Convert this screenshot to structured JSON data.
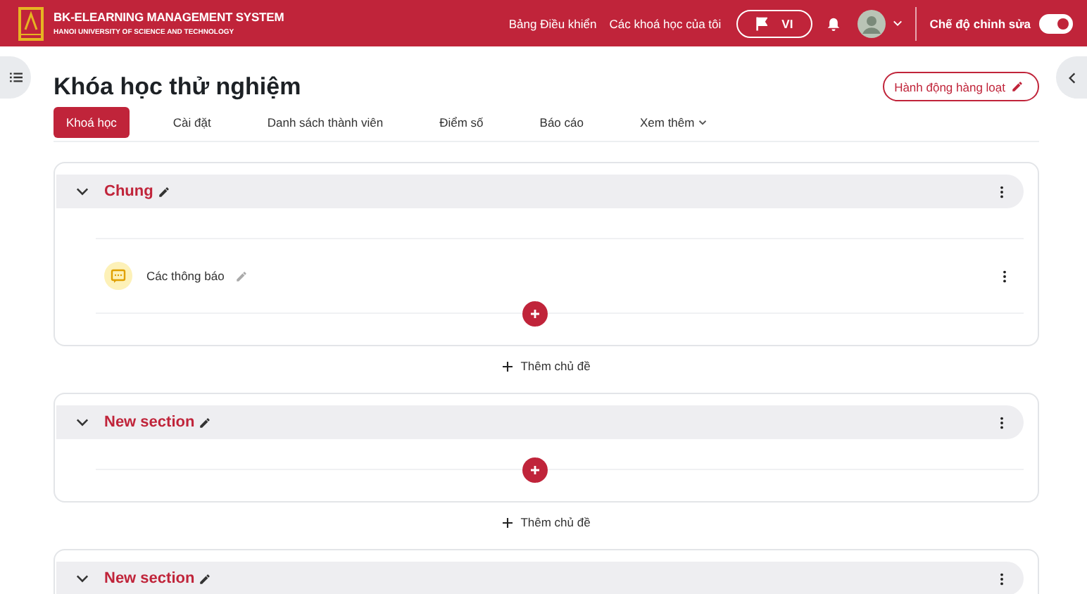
{
  "navbar": {
    "brand_title": "BK-ELEARNING MANAGEMENT SYSTEM",
    "brand_subtitle": "HANOI UNIVERSITY OF SCIENCE AND TECHNOLOGY",
    "links": [
      "Bảng Điều khiển",
      "Các khoá học của tôi"
    ],
    "language": "VI",
    "edit_mode": {
      "label": "Chế độ chỉnh sửa",
      "on": true
    }
  },
  "course": {
    "title": "Khóa học thử nghiệm",
    "bulk_button": "Hành động hàng loạt"
  },
  "tabs": [
    {
      "label": "Khoá học",
      "selected": true
    },
    {
      "label": "Cài đặt",
      "selected": false
    },
    {
      "label": "Danh sách thành viên",
      "selected": false
    },
    {
      "label": "Điểm số",
      "selected": false
    },
    {
      "label": "Báo cáo",
      "selected": false
    },
    {
      "label": "Xem thêm",
      "selected": false,
      "kind": "dropdown"
    }
  ],
  "sections": [
    {
      "title": "Chung",
      "expanded": true,
      "activities": [
        {
          "name": "Các thông báo",
          "kind": "forum"
        }
      ],
      "add_topic": "Thêm chủ đề"
    },
    {
      "title": "New section",
      "expanded": true,
      "add_topic": "Thêm chủ đề"
    },
    {
      "title": "New section",
      "expanded": true
    }
  ]
}
